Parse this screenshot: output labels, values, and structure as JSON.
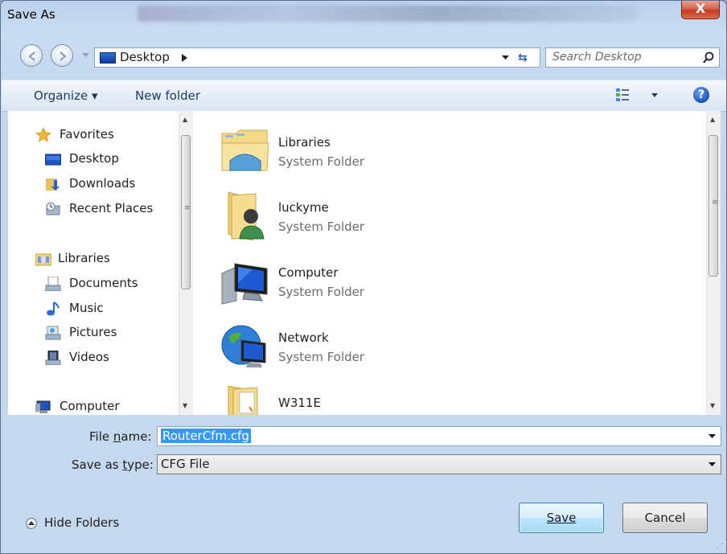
{
  "window": {
    "title": "Save As",
    "close_glyph": "X"
  },
  "address": {
    "location": "Desktop",
    "search_placeholder": "Search Desktop"
  },
  "toolbar": {
    "organize_label": "Organize ▾",
    "new_folder_label": "New folder",
    "help_glyph": "?"
  },
  "sidebar": {
    "favorites": [
      {
        "label": "Favorites",
        "icon": "star-icon"
      },
      {
        "label": "Desktop",
        "icon": "desktop-icon"
      },
      {
        "label": "Downloads",
        "icon": "downloads-icon"
      },
      {
        "label": "Recent Places",
        "icon": "recent-places-icon"
      }
    ],
    "libraries": [
      {
        "label": "Libraries",
        "icon": "libraries-icon"
      },
      {
        "label": "Documents",
        "icon": "documents-icon"
      },
      {
        "label": "Music",
        "icon": "music-icon"
      },
      {
        "label": "Pictures",
        "icon": "pictures-icon"
      },
      {
        "label": "Videos",
        "icon": "videos-icon"
      }
    ],
    "computer": {
      "label": "Computer",
      "icon": "computer-icon"
    }
  },
  "files": [
    {
      "name": "Libraries",
      "type": "System Folder",
      "icon": "libraries-folder-icon"
    },
    {
      "name": "luckyme",
      "type": "System Folder",
      "icon": "user-folder-icon"
    },
    {
      "name": "Computer",
      "type": "System Folder",
      "icon": "computer-icon"
    },
    {
      "name": "Network",
      "type": "System Folder",
      "icon": "network-icon"
    },
    {
      "name": "W311E",
      "type": "",
      "icon": "folder-icon"
    }
  ],
  "form": {
    "filename_label": "File name:",
    "filename_value": "RouterCfm.cfg",
    "savetype_label": "Save as type:",
    "savetype_value": "CFG File"
  },
  "footer": {
    "hide_folders_label": "Hide Folders",
    "save_label": "Save",
    "cancel_label": "Cancel"
  }
}
